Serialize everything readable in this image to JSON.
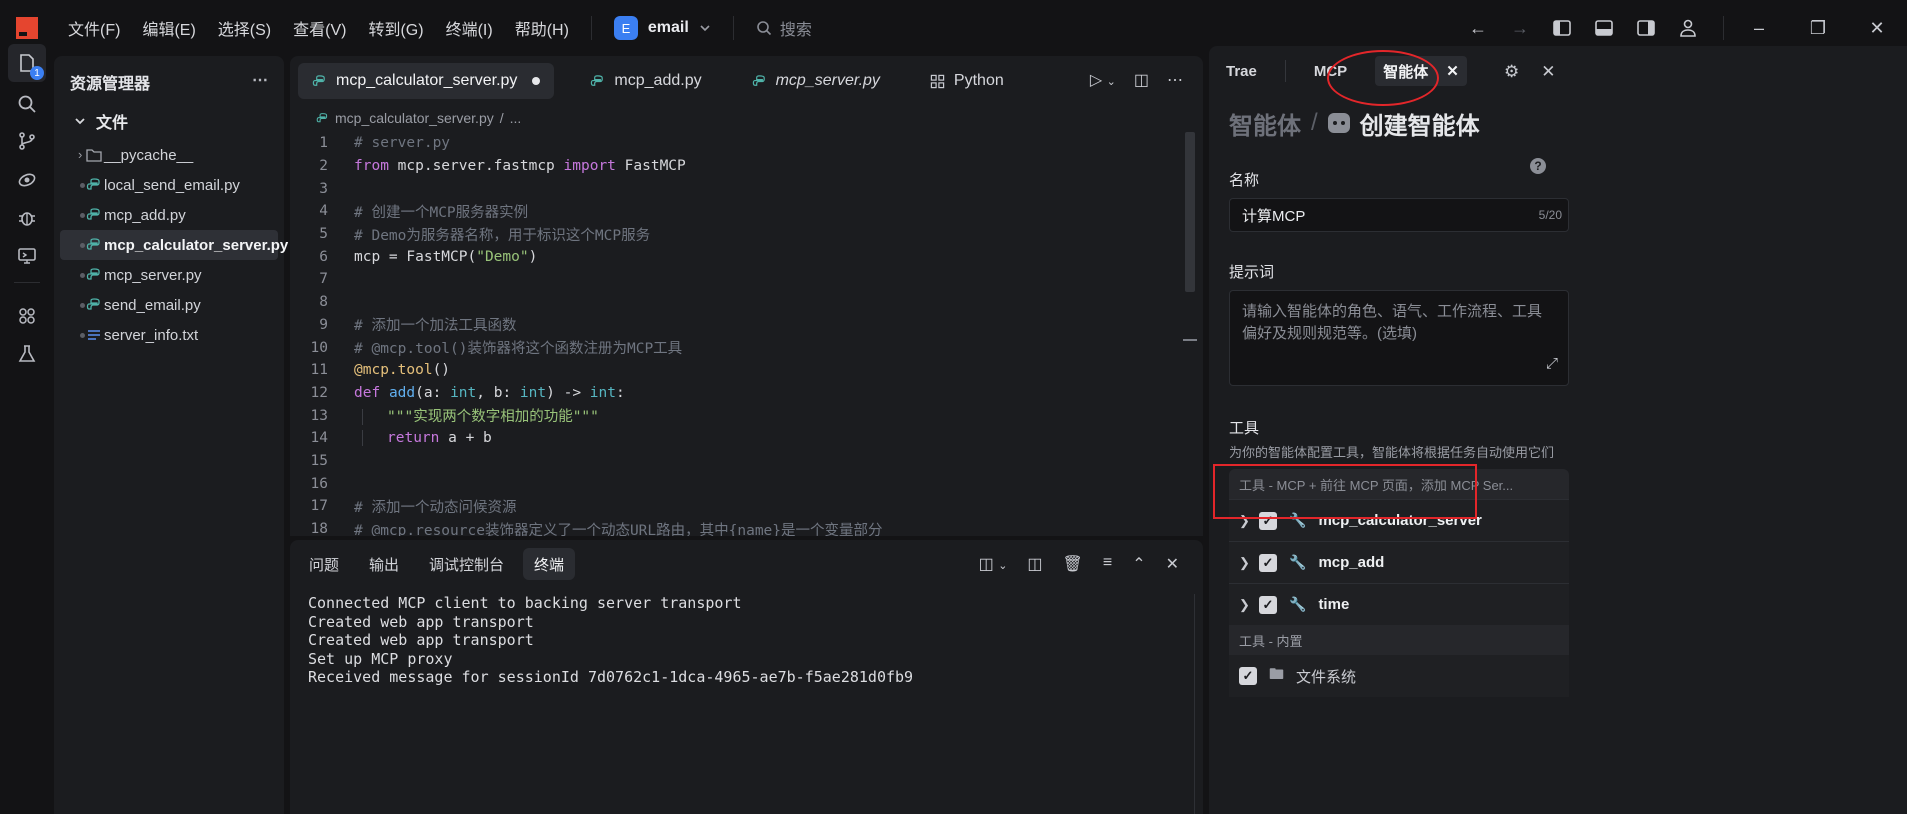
{
  "titlebar": {
    "menu": [
      "文件(F)",
      "编辑(E)",
      "选择(S)",
      "查看(V)",
      "转到(G)",
      "终端(I)",
      "帮助(H)"
    ],
    "workspace_badge": "E",
    "workspace_name": "email",
    "search_label": "搜索"
  },
  "activity": {
    "explorer_badge": "1"
  },
  "explorer": {
    "title": "资源管理器",
    "folder": "文件",
    "items": [
      {
        "label": "__pycache__",
        "type": "folder"
      },
      {
        "label": "local_send_email.py",
        "type": "py"
      },
      {
        "label": "mcp_add.py",
        "type": "py"
      },
      {
        "label": "mcp_calculator_server.py",
        "type": "py",
        "selected": true
      },
      {
        "label": "mcp_server.py",
        "type": "py"
      },
      {
        "label": "send_email.py",
        "type": "py"
      },
      {
        "label": "server_info.txt",
        "type": "txt"
      }
    ]
  },
  "editor": {
    "tabs": [
      {
        "label": "mcp_calculator_server.py",
        "active": true,
        "modified": true
      },
      {
        "label": "mcp_add.py"
      },
      {
        "label": "mcp_server.py",
        "italic": true
      },
      {
        "label": "Python"
      }
    ],
    "breadcrumb_file": "mcp_calculator_server.py",
    "breadcrumb_more": "...",
    "lines": [
      {
        "n": "1",
        "html": "<span style='color:#6f7580'># server.py</span>"
      },
      {
        "n": "2",
        "html": "<span style='color:#c678dd'>from</span> mcp.server.fastmcp <span style='color:#c678dd'>import</span> FastMCP"
      },
      {
        "n": "3",
        "html": ""
      },
      {
        "n": "4",
        "html": "<span style='color:#6f7580'># 创建一个MCP服务器实例</span>"
      },
      {
        "n": "5",
        "html": "<span style='color:#6f7580'># Demo为服务器名称，用于标识这个MCP服务</span>"
      },
      {
        "n": "6",
        "html": "mcp = FastMCP(<span style='color:#98c379'>\"Demo\"</span>)"
      },
      {
        "n": "7",
        "html": ""
      },
      {
        "n": "8",
        "html": ""
      },
      {
        "n": "9",
        "html": "<span style='color:#6f7580'># 添加一个加法工具函数</span>"
      },
      {
        "n": "10",
        "html": "<span style='color:#6f7580'># @mcp.tool()装饰器将这个函数注册为MCP工具</span>"
      },
      {
        "n": "11",
        "html": "<span style='color:#e5c07b'>@mcp.tool</span>()"
      },
      {
        "n": "12",
        "html": "<span style='color:#c678dd'>def</span> <span style='color:#61afef'>add</span>(a: <span style='color:#56b6c2'>int</span>, b: <span style='color:#56b6c2'>int</span>) -> <span style='color:#56b6c2'>int</span>:"
      },
      {
        "n": "13",
        "html": "<span class='guide'><span style='color:#98c379'>\"\"\"实现两个数字相加的功能\"\"\"</span></span>"
      },
      {
        "n": "14",
        "html": "<span class='guide'><span style='color:#c678dd'>return</span> a + b</span>"
      },
      {
        "n": "15",
        "html": ""
      },
      {
        "n": "16",
        "html": ""
      },
      {
        "n": "17",
        "html": "<span style='color:#6f7580'># 添加一个动态问候资源</span>"
      },
      {
        "n": "18",
        "html": "<span style='color:#6f7580'># @mcp.resource装饰器定义了一个动态URL路由，其中{name}是一个变量部分</span>"
      }
    ]
  },
  "panel": {
    "tabs": [
      "问题",
      "输出",
      "调试控制台",
      "终端"
    ],
    "active_tab": "终端",
    "terminal_lines": [
      "Connected MCP client to backing server transport",
      "Created web app transport",
      "Created web app transport",
      "Set up MCP proxy",
      "Received message for sessionId 7d0762c1-1dca-4965-ae7b-f5ae281d0fb9"
    ]
  },
  "agent": {
    "tabs": [
      "Trae",
      "MCP",
      "智能体"
    ],
    "active_tab": "智能体",
    "crumb_parent": "智能体",
    "crumb_current": "创建智能体",
    "name_label": "名称",
    "name_value": "计算MCP",
    "name_count": "5/20",
    "prompt_label": "提示词",
    "prompt_placeholder": "请输入智能体的角色、语气、工作流程、工具偏好及规则规范等。(选填)",
    "tools_label": "工具",
    "tools_desc": "为你的智能体配置工具，智能体将根据任务自动使用它们",
    "tools_mcp_header": "工具 - MCP   + 前往 MCP 页面，添加 MCP Ser...",
    "mcp_tools": [
      "mcp_calculator_server",
      "mcp_add",
      "time"
    ],
    "builtin_header": "工具 - 内置",
    "builtin_tools": [
      "文件系统"
    ]
  },
  "colors": {
    "accent": "#3b7ff2",
    "annotation": "#e3262a",
    "logo": "#e5452f"
  }
}
